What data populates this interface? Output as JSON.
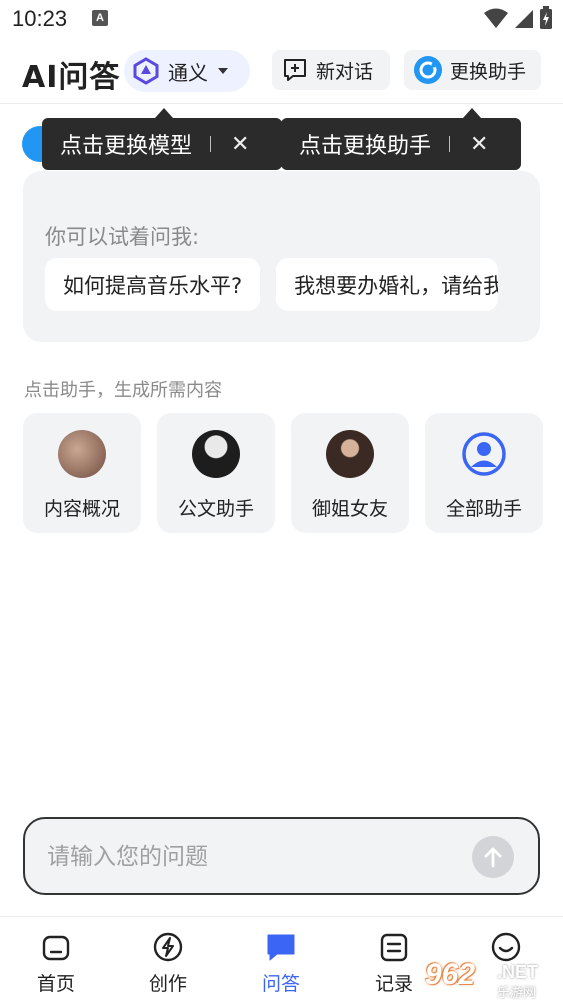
{
  "status_bar": {
    "time": "10:23",
    "notification_letter": "A"
  },
  "header": {
    "title": "AI问答",
    "model": {
      "label": "通义",
      "icon": "tongyi-logo-icon"
    },
    "new_chat": {
      "label": "新对话",
      "icon": "new-chat-icon"
    },
    "switch_assistant": {
      "label": "更换助手",
      "icon": "assistant-logo-icon"
    }
  },
  "tooltips": [
    {
      "text": "点击更换模型",
      "close": "✕"
    },
    {
      "text": "点击更换助手",
      "close": "✕"
    }
  ],
  "suggestions": {
    "hint": "你可以试着问我:",
    "items": [
      "如何提高音乐水平?",
      "我想要办婚礼，请给我一些建议"
    ]
  },
  "assistants_section": {
    "title": "点击助手，生成所需内容",
    "items": [
      {
        "label": "内容概况",
        "icon": "content-summary-avatar"
      },
      {
        "label": "公文助手",
        "icon": "document-assistant-avatar"
      },
      {
        "label": "御姐女友",
        "icon": "girlfriend-avatar"
      },
      {
        "label": "全部助手",
        "icon": "user-circle-icon"
      }
    ]
  },
  "input": {
    "placeholder": "请输入您的问题"
  },
  "tabs": [
    {
      "label": "首页",
      "icon": "home-icon",
      "active": false
    },
    {
      "label": "创作",
      "icon": "lightning-icon",
      "active": false
    },
    {
      "label": "问答",
      "icon": "chat-bubble-icon",
      "active": true
    },
    {
      "label": "记录",
      "icon": "document-list-icon",
      "active": false
    },
    {
      "label": "",
      "icon": "smile-icon",
      "active": false
    }
  ],
  "watermark": {
    "number": "962",
    "suffix": ".NET",
    "cn": "乐游网"
  },
  "colors": {
    "accent": "#3b66f5",
    "card_bg": "#f2f3f5",
    "tooltip_bg": "#2b2b2b"
  }
}
